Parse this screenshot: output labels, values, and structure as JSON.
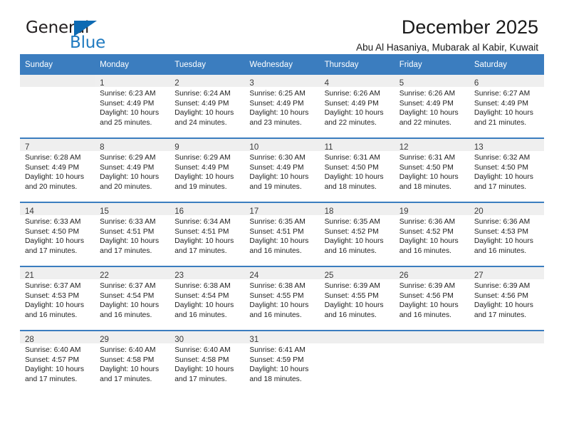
{
  "brand": {
    "name_part1": "General",
    "name_part2": "Blue",
    "triangle_color": "#0d6ab3",
    "blue_color": "#1f7ac0"
  },
  "header": {
    "title": "December 2025",
    "subtitle": "Abu Al Hasaniya, Mubarak al Kabir, Kuwait",
    "accent_color": "#3b7dbf"
  },
  "weekday_headers": [
    "Sunday",
    "Monday",
    "Tuesday",
    "Wednesday",
    "Thursday",
    "Friday",
    "Saturday"
  ],
  "weeks": [
    [
      {
        "day": "",
        "sunrise": "",
        "sunset": "",
        "daylight_line1": "",
        "daylight_line2": ""
      },
      {
        "day": "1",
        "sunrise": "Sunrise: 6:23 AM",
        "sunset": "Sunset: 4:49 PM",
        "daylight_line1": "Daylight: 10 hours",
        "daylight_line2": "and 25 minutes."
      },
      {
        "day": "2",
        "sunrise": "Sunrise: 6:24 AM",
        "sunset": "Sunset: 4:49 PM",
        "daylight_line1": "Daylight: 10 hours",
        "daylight_line2": "and 24 minutes."
      },
      {
        "day": "3",
        "sunrise": "Sunrise: 6:25 AM",
        "sunset": "Sunset: 4:49 PM",
        "daylight_line1": "Daylight: 10 hours",
        "daylight_line2": "and 23 minutes."
      },
      {
        "day": "4",
        "sunrise": "Sunrise: 6:26 AM",
        "sunset": "Sunset: 4:49 PM",
        "daylight_line1": "Daylight: 10 hours",
        "daylight_line2": "and 22 minutes."
      },
      {
        "day": "5",
        "sunrise": "Sunrise: 6:26 AM",
        "sunset": "Sunset: 4:49 PM",
        "daylight_line1": "Daylight: 10 hours",
        "daylight_line2": "and 22 minutes."
      },
      {
        "day": "6",
        "sunrise": "Sunrise: 6:27 AM",
        "sunset": "Sunset: 4:49 PM",
        "daylight_line1": "Daylight: 10 hours",
        "daylight_line2": "and 21 minutes."
      }
    ],
    [
      {
        "day": "7",
        "sunrise": "Sunrise: 6:28 AM",
        "sunset": "Sunset: 4:49 PM",
        "daylight_line1": "Daylight: 10 hours",
        "daylight_line2": "and 20 minutes."
      },
      {
        "day": "8",
        "sunrise": "Sunrise: 6:29 AM",
        "sunset": "Sunset: 4:49 PM",
        "daylight_line1": "Daylight: 10 hours",
        "daylight_line2": "and 20 minutes."
      },
      {
        "day": "9",
        "sunrise": "Sunrise: 6:29 AM",
        "sunset": "Sunset: 4:49 PM",
        "daylight_line1": "Daylight: 10 hours",
        "daylight_line2": "and 19 minutes."
      },
      {
        "day": "10",
        "sunrise": "Sunrise: 6:30 AM",
        "sunset": "Sunset: 4:49 PM",
        "daylight_line1": "Daylight: 10 hours",
        "daylight_line2": "and 19 minutes."
      },
      {
        "day": "11",
        "sunrise": "Sunrise: 6:31 AM",
        "sunset": "Sunset: 4:50 PM",
        "daylight_line1": "Daylight: 10 hours",
        "daylight_line2": "and 18 minutes."
      },
      {
        "day": "12",
        "sunrise": "Sunrise: 6:31 AM",
        "sunset": "Sunset: 4:50 PM",
        "daylight_line1": "Daylight: 10 hours",
        "daylight_line2": "and 18 minutes."
      },
      {
        "day": "13",
        "sunrise": "Sunrise: 6:32 AM",
        "sunset": "Sunset: 4:50 PM",
        "daylight_line1": "Daylight: 10 hours",
        "daylight_line2": "and 17 minutes."
      }
    ],
    [
      {
        "day": "14",
        "sunrise": "Sunrise: 6:33 AM",
        "sunset": "Sunset: 4:50 PM",
        "daylight_line1": "Daylight: 10 hours",
        "daylight_line2": "and 17 minutes."
      },
      {
        "day": "15",
        "sunrise": "Sunrise: 6:33 AM",
        "sunset": "Sunset: 4:51 PM",
        "daylight_line1": "Daylight: 10 hours",
        "daylight_line2": "and 17 minutes."
      },
      {
        "day": "16",
        "sunrise": "Sunrise: 6:34 AM",
        "sunset": "Sunset: 4:51 PM",
        "daylight_line1": "Daylight: 10 hours",
        "daylight_line2": "and 17 minutes."
      },
      {
        "day": "17",
        "sunrise": "Sunrise: 6:35 AM",
        "sunset": "Sunset: 4:51 PM",
        "daylight_line1": "Daylight: 10 hours",
        "daylight_line2": "and 16 minutes."
      },
      {
        "day": "18",
        "sunrise": "Sunrise: 6:35 AM",
        "sunset": "Sunset: 4:52 PM",
        "daylight_line1": "Daylight: 10 hours",
        "daylight_line2": "and 16 minutes."
      },
      {
        "day": "19",
        "sunrise": "Sunrise: 6:36 AM",
        "sunset": "Sunset: 4:52 PM",
        "daylight_line1": "Daylight: 10 hours",
        "daylight_line2": "and 16 minutes."
      },
      {
        "day": "20",
        "sunrise": "Sunrise: 6:36 AM",
        "sunset": "Sunset: 4:53 PM",
        "daylight_line1": "Daylight: 10 hours",
        "daylight_line2": "and 16 minutes."
      }
    ],
    [
      {
        "day": "21",
        "sunrise": "Sunrise: 6:37 AM",
        "sunset": "Sunset: 4:53 PM",
        "daylight_line1": "Daylight: 10 hours",
        "daylight_line2": "and 16 minutes."
      },
      {
        "day": "22",
        "sunrise": "Sunrise: 6:37 AM",
        "sunset": "Sunset: 4:54 PM",
        "daylight_line1": "Daylight: 10 hours",
        "daylight_line2": "and 16 minutes."
      },
      {
        "day": "23",
        "sunrise": "Sunrise: 6:38 AM",
        "sunset": "Sunset: 4:54 PM",
        "daylight_line1": "Daylight: 10 hours",
        "daylight_line2": "and 16 minutes."
      },
      {
        "day": "24",
        "sunrise": "Sunrise: 6:38 AM",
        "sunset": "Sunset: 4:55 PM",
        "daylight_line1": "Daylight: 10 hours",
        "daylight_line2": "and 16 minutes."
      },
      {
        "day": "25",
        "sunrise": "Sunrise: 6:39 AM",
        "sunset": "Sunset: 4:55 PM",
        "daylight_line1": "Daylight: 10 hours",
        "daylight_line2": "and 16 minutes."
      },
      {
        "day": "26",
        "sunrise": "Sunrise: 6:39 AM",
        "sunset": "Sunset: 4:56 PM",
        "daylight_line1": "Daylight: 10 hours",
        "daylight_line2": "and 16 minutes."
      },
      {
        "day": "27",
        "sunrise": "Sunrise: 6:39 AM",
        "sunset": "Sunset: 4:56 PM",
        "daylight_line1": "Daylight: 10 hours",
        "daylight_line2": "and 17 minutes."
      }
    ],
    [
      {
        "day": "28",
        "sunrise": "Sunrise: 6:40 AM",
        "sunset": "Sunset: 4:57 PM",
        "daylight_line1": "Daylight: 10 hours",
        "daylight_line2": "and 17 minutes."
      },
      {
        "day": "29",
        "sunrise": "Sunrise: 6:40 AM",
        "sunset": "Sunset: 4:58 PM",
        "daylight_line1": "Daylight: 10 hours",
        "daylight_line2": "and 17 minutes."
      },
      {
        "day": "30",
        "sunrise": "Sunrise: 6:40 AM",
        "sunset": "Sunset: 4:58 PM",
        "daylight_line1": "Daylight: 10 hours",
        "daylight_line2": "and 17 minutes."
      },
      {
        "day": "31",
        "sunrise": "Sunrise: 6:41 AM",
        "sunset": "Sunset: 4:59 PM",
        "daylight_line1": "Daylight: 10 hours",
        "daylight_line2": "and 18 minutes."
      },
      {
        "day": "",
        "sunrise": "",
        "sunset": "",
        "daylight_line1": "",
        "daylight_line2": ""
      },
      {
        "day": "",
        "sunrise": "",
        "sunset": "",
        "daylight_line1": "",
        "daylight_line2": ""
      },
      {
        "day": "",
        "sunrise": "",
        "sunset": "",
        "daylight_line1": "",
        "daylight_line2": ""
      }
    ]
  ]
}
